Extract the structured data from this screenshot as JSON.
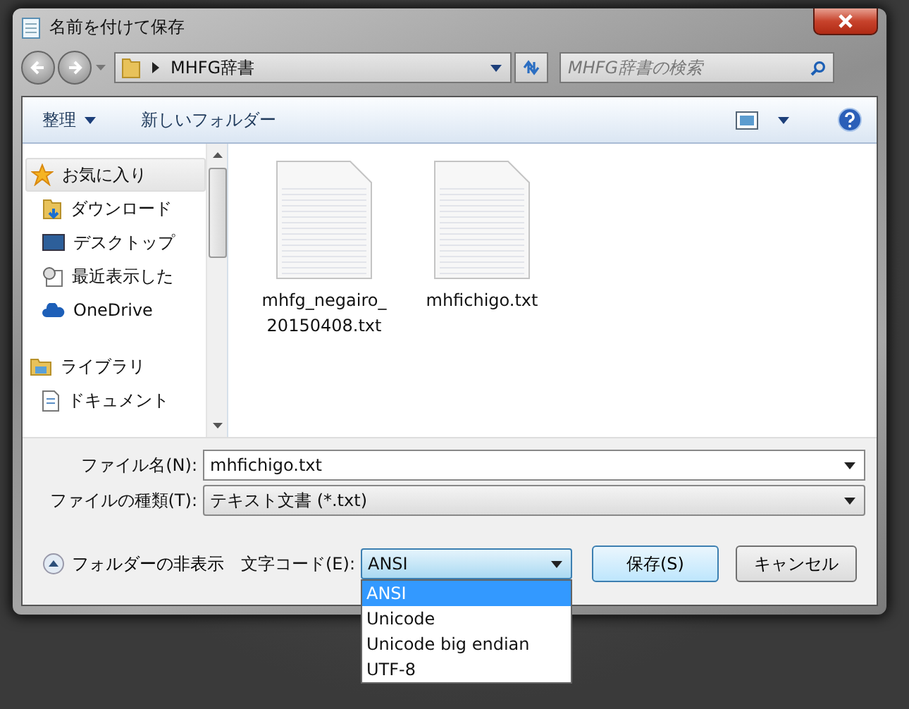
{
  "window": {
    "title": "名前を付けて保存"
  },
  "address_bar": {
    "path": "MHFG辞書"
  },
  "search": {
    "placeholder": "MHFG辞書の検索"
  },
  "toolbar": {
    "organize": "整理",
    "new_folder": "新しいフォルダー"
  },
  "sidebar": {
    "groups": [
      {
        "label": "お気に入り",
        "selected": true,
        "children": [
          {
            "label": "ダウンロード"
          },
          {
            "label": "デスクトップ"
          },
          {
            "label": "最近表示した"
          },
          {
            "label": "OneDrive"
          }
        ]
      },
      {
        "label": "ライブラリ",
        "selected": false,
        "children": [
          {
            "label": "ドキュメント"
          }
        ]
      }
    ]
  },
  "files": [
    {
      "name": "mhfg_negairo_20150408.txt"
    },
    {
      "name": "mhfichigo.txt"
    }
  ],
  "form": {
    "file_name": {
      "label": "ファイル名(N):",
      "value": "mhfichigo.txt"
    },
    "file_type": {
      "label": "ファイルの種類(T):",
      "value": "テキスト文書 (*.txt)"
    },
    "hide_folders": "フォルダーの非表示",
    "encoding": {
      "label": "文字コード(E):",
      "value": "ANSI",
      "expanded": true,
      "options": [
        {
          "label": "ANSI",
          "selected": true
        },
        {
          "label": "Unicode",
          "selected": false
        },
        {
          "label": "Unicode big endian",
          "selected": false
        },
        {
          "label": "UTF-8",
          "selected": false
        }
      ]
    },
    "buttons": [
      "保存(S)",
      "キャンセル"
    ]
  }
}
